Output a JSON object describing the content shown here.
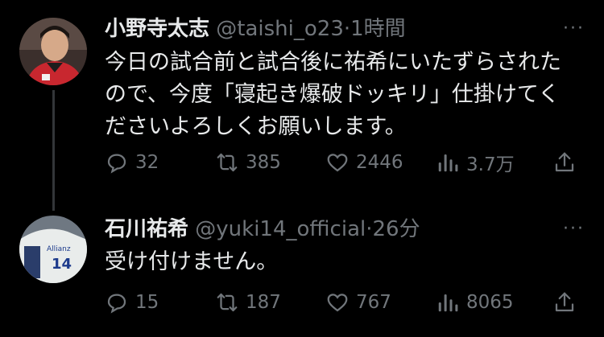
{
  "tweets": [
    {
      "name": "小野寺太志",
      "handle": "@taishi_o23",
      "separator": "·",
      "time": "1時間",
      "lines": [
        "今日の試合前と試合後に祐希にいたずらされた",
        "ので、今度「寝起き爆破ドッキリ」仕掛けてく",
        "ださいよろしくお願いします。"
      ],
      "replies": "32",
      "retweets": "385",
      "likes": "2446",
      "views": "3.7万"
    },
    {
      "name": "石川祐希",
      "handle": "@yuki14_official",
      "separator": "·",
      "time": "26分",
      "lines": [
        "受け付けません。"
      ],
      "replies": "15",
      "retweets": "187",
      "likes": "767",
      "views": "8065"
    }
  ],
  "icons": {
    "reply": "speech-bubble-icon",
    "retweet": "retweet-icon",
    "like": "heart-icon",
    "views": "bar-chart-icon",
    "share": "share-icon",
    "more": "more-icon"
  },
  "more_glyph": "···"
}
